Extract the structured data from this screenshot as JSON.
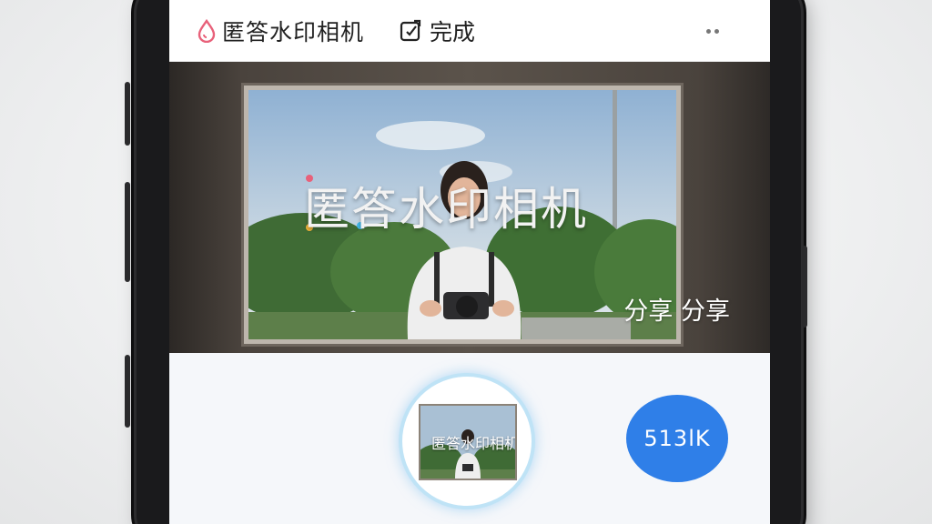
{
  "app": {
    "title": "匿答水印相机",
    "done_label": "完成"
  },
  "preview": {
    "watermark_text": "匿答水印相机",
    "share_label": "分享 分享"
  },
  "thumbnail": {
    "watermark_text": "匿答水印相机"
  },
  "capture_button": {
    "label": "513lK"
  },
  "colors": {
    "accent_blue": "#2f7fe8",
    "brand_pink": "#e8617a",
    "ring_glow": "#bfe3f6"
  },
  "icons": {
    "brand": "water-drop-icon",
    "done": "edit-square-icon",
    "more": "more-dots-icon"
  }
}
